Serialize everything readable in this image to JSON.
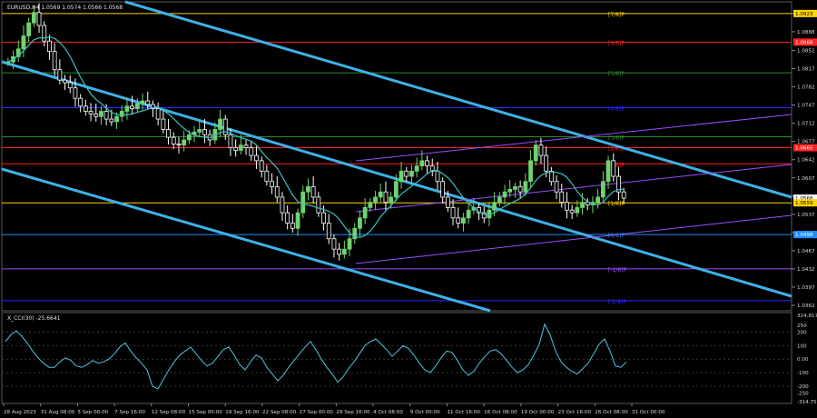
{
  "symbol_header": "EURUSD,H4  1.0569 1.0574 1.0566 1.0568",
  "indicator_header": "X_CCI(30) -25.6641",
  "colors": {
    "background": "#000000",
    "bull_candle": "#6fd36f",
    "bear_candle": "#ffffff",
    "channel": "#3fb0e6",
    "purple_channel": "#9b4dff",
    "ma": "#3cc0c0",
    "resistance": "#ff2020",
    "support": "#ff2020",
    "cci_line": "#4fc3e0",
    "current_price_bg": "#ffffff"
  },
  "price_axis": {
    "labels": [
      "1.0923",
      "1.0888",
      "1.0852",
      "1.0817",
      "1.0782",
      "1.0747",
      "1.0712",
      "1.0677",
      "1.0642",
      "1.0607",
      "1.0572",
      "1.0537",
      "1.0502",
      "1.0467",
      "1.0432",
      "1.0397",
      "1.0362"
    ],
    "badges": [
      {
        "text": "1.0923",
        "color": "#ffd400",
        "text_color": "#000",
        "price": 1.0923
      },
      {
        "text": "1.0868",
        "color": "#ff2020",
        "text_color": "#fff",
        "price": 1.0868
      },
      {
        "text": "1.0665",
        "color": "#ff2020",
        "text_color": "#fff",
        "price": 1.0665
      },
      {
        "text": "1.0568",
        "color": "#ffffff",
        "text_color": "#000",
        "price": 1.0568
      },
      {
        "text": "1.0559",
        "color": "#ffd400",
        "text_color": "#000",
        "price": 1.0559
      },
      {
        "text": "1.0498",
        "color": "#1e90ff",
        "text_color": "#fff",
        "price": 1.0498
      }
    ]
  },
  "murrey_levels": [
    {
      "label": "[7/8]P",
      "price": 1.0923,
      "color": "#ffd400"
    },
    {
      "label": "[6/8]P",
      "price": 1.0868,
      "color": "#ff2020"
    },
    {
      "label": "[5/8]P",
      "price": 1.0809,
      "color": "#2e8b2e"
    },
    {
      "label": "[4/8]P",
      "price": 1.0742,
      "color": "#2a2aff"
    },
    {
      "label": "[3/8]P",
      "price": 1.0686,
      "color": "#2e8b2e"
    },
    {
      "label": "[2/8]P",
      "price": 1.0665,
      "color": "#ff2020"
    },
    {
      "label": "[2/8]P",
      "price": 1.0634,
      "color": "#ff2020"
    },
    {
      "label": "[1/8]P",
      "price": 1.0559,
      "color": "#ffd400"
    },
    {
      "label": "[0/8]P",
      "price": 1.0498,
      "color": "#1e90ff"
    },
    {
      "label": "[-1/8]P",
      "price": 1.0432,
      "color": "#9b4dff"
    },
    {
      "label": "[-2/8]P",
      "price": 1.0371,
      "color": "#2a2aff"
    }
  ],
  "cci_axis": {
    "labels": [
      "324.8172",
      "250",
      "200",
      "100",
      "0.00",
      "-100",
      "-200",
      "-250",
      "-314.7588"
    ]
  },
  "time_axis": {
    "labels": [
      "28 Aug 2023",
      "31 Aug 08:00",
      "5 Sep 00:00",
      "7 Sep 16:00",
      "12 Sep 08:00",
      "15 Sep 00:00",
      "19 Sep 16:00",
      "22 Sep 08:00",
      "27 Sep 00:00",
      "29 Sep 16:00",
      "4 Oct 08:00",
      "9 Oct 00:00",
      "11 Oct 16:00",
      "16 Oct 08:00",
      "19 Oct 00:00",
      "23 Oct 16:00",
      "26 Oct 08:00",
      "31 Oct 00:00"
    ]
  },
  "chart_data": {
    "type": "candlestick",
    "symbol": "EURUSD",
    "timeframe": "H4",
    "ylim": [
      1.0355,
      1.0935
    ],
    "close_path": [
      1.083,
      1.084,
      1.0855,
      1.088,
      1.0905,
      1.0925,
      1.09,
      1.087,
      1.085,
      1.0815,
      1.0795,
      1.079,
      1.078,
      1.076,
      1.0745,
      1.0735,
      1.073,
      1.0725,
      1.0735,
      1.072,
      1.0715,
      1.0725,
      1.0735,
      1.0745,
      1.074,
      1.075,
      1.0755,
      1.0748,
      1.074,
      1.072,
      1.07,
      1.0685,
      1.0672,
      1.067,
      1.068,
      1.069,
      1.0695,
      1.07,
      1.069,
      1.068,
      1.07,
      1.072,
      1.069,
      1.0665,
      1.066,
      1.067,
      1.0665,
      1.065,
      1.064,
      1.062,
      1.06,
      1.059,
      1.057,
      1.054,
      1.052,
      1.051,
      1.054,
      1.058,
      1.059,
      1.057,
      1.054,
      1.052,
      1.049,
      1.047,
      1.046,
      1.047,
      1.049,
      1.051,
      1.053,
      1.055,
      1.056,
      1.057,
      1.058,
      1.056,
      1.057,
      1.06,
      1.062,
      1.061,
      1.062,
      1.063,
      1.064,
      1.063,
      1.062,
      1.06,
      1.057,
      1.055,
      1.053,
      1.052,
      1.053,
      1.0545,
      1.055,
      1.054,
      1.053,
      1.0545,
      1.056,
      1.057,
      1.058,
      1.0585,
      1.059,
      1.058,
      1.06,
      1.064,
      1.067,
      1.065,
      1.062,
      1.06,
      1.058,
      1.056,
      1.0545,
      1.054,
      1.055,
      1.056,
      1.0555,
      1.056,
      1.057,
      1.06,
      1.064,
      1.061,
      1.058,
      1.0568
    ],
    "cci_path": [
      130,
      180,
      210,
      170,
      120,
      60,
      10,
      -30,
      -60,
      -60,
      -20,
      10,
      -10,
      -50,
      -60,
      -40,
      -10,
      -30,
      -20,
      0,
      40,
      90,
      120,
      60,
      10,
      -30,
      -80,
      -200,
      -220,
      -150,
      -80,
      -20,
      30,
      60,
      90,
      40,
      -10,
      -50,
      -30,
      20,
      70,
      90,
      30,
      -40,
      -80,
      -20,
      30,
      10,
      -60,
      -110,
      -160,
      -120,
      -60,
      -10,
      40,
      90,
      130,
      70,
      0,
      -60,
      -110,
      -170,
      -130,
      -70,
      -20,
      40,
      100,
      130,
      150,
      110,
      70,
      20,
      60,
      100,
      80,
      30,
      -30,
      -80,
      -100,
      -50,
      10,
      60,
      50,
      -10,
      -80,
      -120,
      -90,
      -30,
      20,
      60,
      70,
      40,
      -10,
      -60,
      -100,
      -80,
      -40,
      30,
      110,
      260,
      180,
      60,
      -20,
      -60,
      -90,
      -110,
      -70,
      -30,
      40,
      110,
      150,
      60,
      -50,
      -60,
      -20
    ]
  }
}
